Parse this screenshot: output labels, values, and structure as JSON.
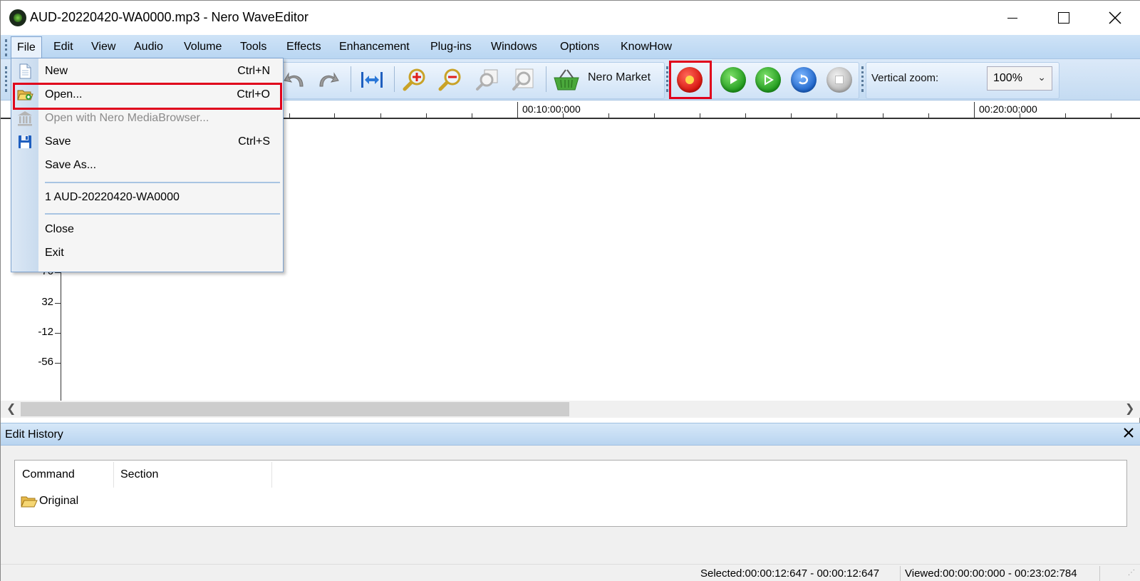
{
  "window": {
    "title": "AUD-20220420-WA0000.mp3 - Nero WaveEditor"
  },
  "menubar": {
    "items": [
      "File",
      "Edit",
      "View",
      "Audio",
      "Volume",
      "Tools",
      "Effects",
      "Enhancement",
      "Plug-ins",
      "Windows",
      "Options",
      "KnowHow"
    ]
  },
  "file_menu": {
    "items": [
      {
        "label": "New",
        "shortcut": "Ctrl+N",
        "icon": "new-document-icon",
        "enabled": true
      },
      {
        "label": "Open...",
        "shortcut": "Ctrl+O",
        "icon": "open-folder-icon",
        "enabled": true,
        "highlighted": true
      },
      {
        "label": "Open with Nero MediaBrowser...",
        "shortcut": "",
        "icon": "media-browser-icon",
        "enabled": false
      },
      {
        "label": "Save",
        "shortcut": "Ctrl+S",
        "icon": "save-disk-icon",
        "enabled": true
      },
      {
        "label": "Save As...",
        "shortcut": "",
        "icon": "",
        "enabled": true
      },
      {
        "label": "1 AUD-20220420-WA0000",
        "shortcut": "",
        "icon": "",
        "enabled": true
      },
      {
        "label": "Close",
        "shortcut": "",
        "icon": "",
        "enabled": true
      },
      {
        "label": "Exit",
        "shortcut": "",
        "icon": "",
        "enabled": true
      }
    ]
  },
  "toolbar": {
    "nero_market_label": "Nero Market",
    "vertical_zoom_label": "Vertical zoom:",
    "vertical_zoom_value": "100%",
    "record_color": "#e0201b",
    "play_color": "#2ea52b",
    "loop_color": "#2479d6",
    "stop_color": "#b9b9b9"
  },
  "ruler": {
    "labels": [
      "00:10:00:000",
      "00:20:00:000"
    ]
  },
  "wave_axis": {
    "labels": [
      "76",
      "32",
      "-12",
      "-56"
    ]
  },
  "edit_history": {
    "title": "Edit History",
    "columns": [
      "Command",
      "Section"
    ],
    "rows": [
      {
        "command": "Original",
        "section": ""
      }
    ]
  },
  "statusbar": {
    "selected": "Selected:00:00:12:647 - 00:00:12:647",
    "viewed": "Viewed:00:00:00:000 - 00:23:02:784"
  },
  "colors": {
    "highlight_border": "#e0001b",
    "menubar_bg": "#c4dbf2"
  }
}
